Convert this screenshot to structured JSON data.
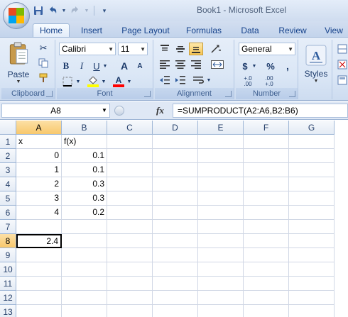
{
  "window": {
    "title": "Book1 - Microsoft Excel"
  },
  "qat": {
    "icons": [
      "save-icon",
      "undo-icon",
      "redo-icon",
      "customize-icon"
    ]
  },
  "tabs": [
    {
      "label": "Home",
      "active": true
    },
    {
      "label": "Insert"
    },
    {
      "label": "Page Layout"
    },
    {
      "label": "Formulas"
    },
    {
      "label": "Data"
    },
    {
      "label": "Review"
    },
    {
      "label": "View"
    }
  ],
  "ribbon": {
    "clipboard": {
      "label": "Clipboard",
      "paste_label": "Paste"
    },
    "font": {
      "label": "Font",
      "font_name": "Calibri",
      "font_size": "11",
      "bold": "B",
      "italic": "I",
      "underline": "U",
      "grow": "A",
      "shrink": "A",
      "font_color": "A"
    },
    "alignment": {
      "label": "Alignment"
    },
    "number": {
      "label": "Number",
      "format": "General",
      "currency": "$",
      "percent": "%",
      "comma": ",",
      "inc_decimal": "+.0 .00",
      "dec_decimal": ".00 +.0"
    },
    "styles": {
      "label": "Styles"
    },
    "colors": {
      "accent": "#15428b",
      "font_color_bar": "#ff0000",
      "fill_color_bar": "#ffff00"
    }
  },
  "formula_bar": {
    "name_box": "A8",
    "fx": "fx",
    "formula": "=SUMPRODUCT(A2:A6,B2:B6)"
  },
  "sheet": {
    "columns": [
      "A",
      "B",
      "C",
      "D",
      "E",
      "F",
      "G"
    ],
    "selected_column": "A",
    "selected_row": "8",
    "rows": [
      {
        "num": "1",
        "a": "x",
        "b": "f(x)"
      },
      {
        "num": "2",
        "a": "0",
        "b": "0.1"
      },
      {
        "num": "3",
        "a": "1",
        "b": "0.1"
      },
      {
        "num": "4",
        "a": "2",
        "b": "0.3"
      },
      {
        "num": "5",
        "a": "3",
        "b": "0.3"
      },
      {
        "num": "6",
        "a": "4",
        "b": "0.2"
      },
      {
        "num": "7",
        "a": "",
        "b": ""
      },
      {
        "num": "8",
        "a": "2.4",
        "b": ""
      },
      {
        "num": "9",
        "a": "",
        "b": ""
      },
      {
        "num": "10",
        "a": "",
        "b": ""
      },
      {
        "num": "11",
        "a": "",
        "b": ""
      },
      {
        "num": "12",
        "a": "",
        "b": ""
      },
      {
        "num": "13",
        "a": "",
        "b": ""
      }
    ]
  }
}
